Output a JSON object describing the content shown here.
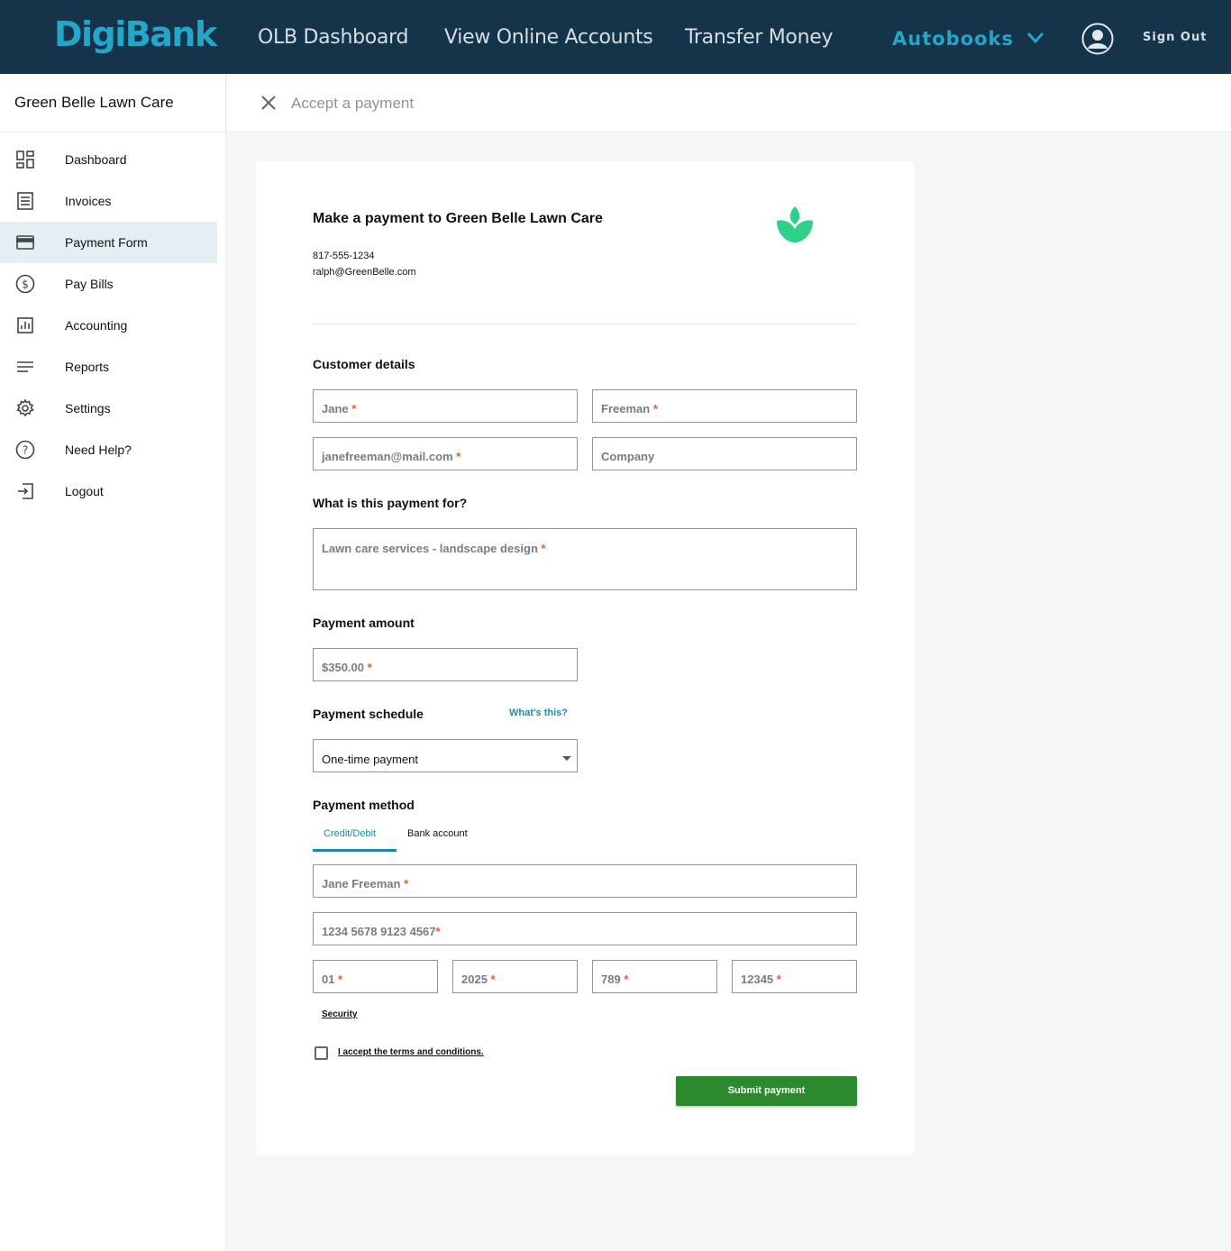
{
  "topbar": {
    "logo": "DigiBank",
    "nav": [
      "OLB Dashboard",
      "View Online Accounts",
      "Transfer Money"
    ],
    "active_nav": "Autobooks",
    "sign_out": "Sign Out"
  },
  "sidebar": {
    "business_name": "Green Belle Lawn Care",
    "items": [
      {
        "label": "Dashboard",
        "icon": "dashboard-icon"
      },
      {
        "label": "Invoices",
        "icon": "invoice-icon"
      },
      {
        "label": "Payment Form",
        "icon": "credit-card-icon",
        "active": true
      },
      {
        "label": "Pay Bills",
        "icon": "dollar-circle-icon"
      },
      {
        "label": "Accounting",
        "icon": "bar-chart-icon"
      },
      {
        "label": "Reports",
        "icon": "lines-icon"
      },
      {
        "label": "Settings",
        "icon": "gear-icon"
      },
      {
        "label": "Need Help?",
        "icon": "help-icon"
      },
      {
        "label": "Logout",
        "icon": "logout-icon"
      }
    ]
  },
  "header": {
    "title": "Accept a payment"
  },
  "form": {
    "title": "Make a payment to Green Belle Lawn Care",
    "phone": "817-555-1234",
    "email": "ralph@GreenBelle.com",
    "customer_details_heading": "Customer details",
    "first_name": "Jane",
    "last_name": "Freeman",
    "customer_email": "janefreeman@mail.com",
    "company": "Company",
    "purpose_heading": "What is this payment for?",
    "purpose": "Lawn care services - landscape design",
    "amount_heading": "Payment amount",
    "amount": "$350.00",
    "schedule_heading": "Payment schedule",
    "whats_this": "What’s this?",
    "schedule_value": "One-time payment",
    "method_heading": "Payment method",
    "tabs": [
      "Credit/Debit",
      "Bank account"
    ],
    "cardholder": "Jane Freeman",
    "card_number": "1234 5678 9123 4567",
    "exp_month": "01",
    "exp_year": "2025",
    "cvv": "789",
    "zip": "12345",
    "security_link": "Security",
    "terms": "I accept the terms and conditions.",
    "submit": "Submit payment",
    "required_mark": "*"
  },
  "colors": {
    "topbar": "#153349",
    "brand": "#25a6c9",
    "link": "#1e8aa6",
    "submit": "#2b8a2e",
    "logo_leaf": "#2fd08a",
    "required": "#e0602a"
  }
}
